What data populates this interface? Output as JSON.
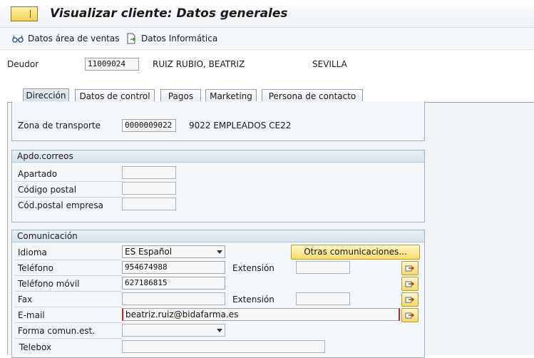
{
  "window": {
    "title": "Visualizar cliente: Datos generales"
  },
  "toolbar": {
    "btn1_label": "Datos área de ventas",
    "btn2_label": "Datos Informática"
  },
  "header": {
    "deudor_label": "Deudor",
    "deudor_value": "11009024",
    "name": "RUIZ RUBIO, BEATRIZ",
    "city": "SEVILLA"
  },
  "tabs": [
    {
      "label": "Dirección",
      "active": true
    },
    {
      "label": "Datos de control",
      "active": false
    },
    {
      "label": "Pagos",
      "active": false
    },
    {
      "label": "Marketing",
      "active": false
    },
    {
      "label": "Persona de contacto",
      "active": false
    }
  ],
  "transport": {
    "label": "Zona de transporte",
    "value": "0000009022",
    "description": "9022 EMPLEADOS CE22"
  },
  "apdo": {
    "title": "Apdo.correos",
    "apartado_label": "Apartado",
    "apartado_value": "",
    "cp_label": "Código postal",
    "cp_value": "",
    "cp_empresa_label": "Cód.postal empresa",
    "cp_empresa_value": ""
  },
  "comunicacion": {
    "title": "Comunicación",
    "idioma_label": "Idioma",
    "idioma_value": "ES Español",
    "otras_button": "Otras comunicaciones...",
    "telefono_label": "Teléfono",
    "telefono_value": "954674988",
    "extension_label": "Extensión",
    "telefono_ext_value": "",
    "movil_label": "Teléfono móvil",
    "movil_value": "627186815",
    "fax_label": "Fax",
    "fax_value": "",
    "fax_ext_label": "Extensión",
    "fax_ext_value": "",
    "email_label": "E-mail",
    "email_value": "beatriz.ruiz@bidafarma.es",
    "forma_label": "Forma comun.est.",
    "forma_value": "",
    "telebox_label": "Telebox",
    "telebox_value": ""
  },
  "colors": {
    "title_bar": "#eef3f8",
    "tab_active": "#d7e1eb",
    "button_yellow": "#f8dc6e",
    "content_bg": "#f0f4f8"
  }
}
